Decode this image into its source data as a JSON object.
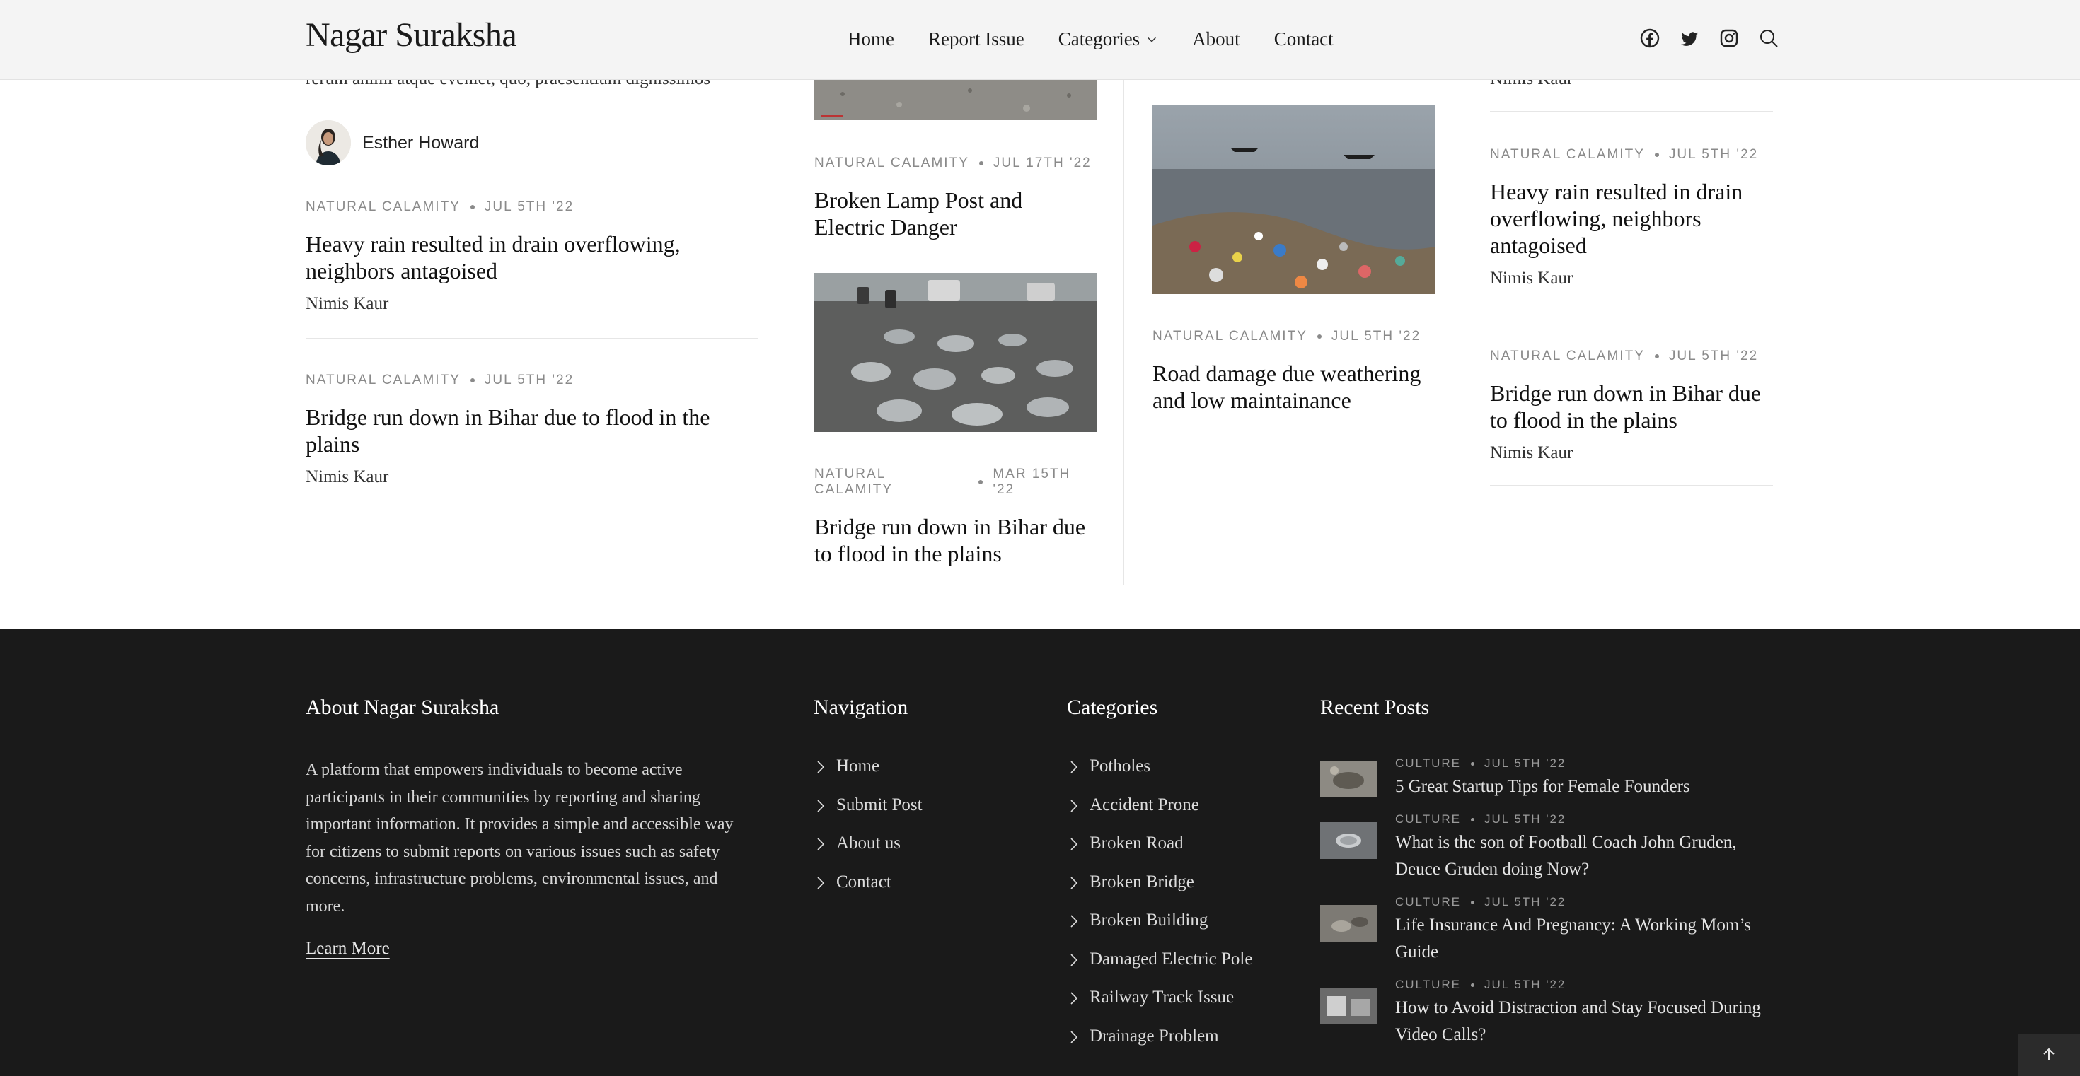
{
  "header": {
    "logo": "Nagar Suraksha",
    "nav": [
      {
        "label": "Home"
      },
      {
        "label": "Report Issue"
      },
      {
        "label": "Categories"
      },
      {
        "label": "About"
      },
      {
        "label": "Contact"
      }
    ]
  },
  "col1": {
    "excerpt_tail": "rerum animi atque eveniet, quo, praesentium dignissimos",
    "author_name": "Esther Howard",
    "posts": [
      {
        "category": "Natural Calamity",
        "date": "Jul 5th '22",
        "title": "Heavy rain resulted in drain overflowing, neighbors antagoised",
        "author": "Nimis Kaur"
      },
      {
        "category": "Natural Calamity",
        "date": "Jul 5th '22",
        "title": "Bridge run down in Bihar due to flood in the plains",
        "author": "Nimis Kaur"
      }
    ]
  },
  "col2": {
    "posts": [
      {
        "category": "Natural Calamity",
        "date": "Jul 17th '22",
        "title": "Broken Lamp Post and Electric Danger"
      },
      {
        "category": "Natural Calamity",
        "date": "Mar 15th '22",
        "title": "Bridge run down in Bihar due to flood in the plains"
      }
    ]
  },
  "col3": {
    "posts": [
      {
        "category": "Natural Calamity",
        "date": "Jul 5th '22",
        "title": "Road damage due weathering and low maintainance"
      }
    ]
  },
  "col4": {
    "top_author": "Nimis Kaur",
    "posts": [
      {
        "category": "Natural Calamity",
        "date": "Jul 5th '22",
        "title": "Heavy rain resulted in drain overflowing, neighbors antagoised",
        "author": "Nimis Kaur"
      },
      {
        "category": "Natural Calamity",
        "date": "Jul 5th '22",
        "title": "Bridge run down in Bihar due to flood in the plains",
        "author": "Nimis Kaur"
      }
    ]
  },
  "footer": {
    "about_heading": "About Nagar Suraksha",
    "about_text": "A platform that empowers individuals to become active participants in their communities by reporting and sharing important information. It provides a simple and accessible way for citizens to submit reports on various issues such as safety concerns, infrastructure problems, environmental issues, and more.",
    "learn_more": "Learn More",
    "nav_heading": "Navigation",
    "nav_links": [
      "Home",
      "Submit Post",
      "About us",
      "Contact"
    ],
    "categories_heading": "Categories",
    "categories": [
      "Potholes",
      "Accident Prone",
      "Broken Road",
      "Broken Bridge",
      "Broken Building",
      "Damaged Electric Pole",
      "Railway Track Issue",
      "Drainage Problem"
    ],
    "recent_heading": "Recent Posts",
    "recent": [
      {
        "category": "Culture",
        "date": "Jul 5th '22",
        "title": "5 Great Startup Tips for Female Founders"
      },
      {
        "category": "Culture",
        "date": "Jul 5th '22",
        "title": "What is the son of Football Coach John Gruden, Deuce Gruden doing Now?"
      },
      {
        "category": "Culture",
        "date": "Jul 5th '22",
        "title": "Life Insurance And Pregnancy: A Working Mom’s Guide"
      },
      {
        "category": "Culture",
        "date": "Jul 5th '22",
        "title": "How to Avoid Distraction and Stay Focused During Video Calls?"
      }
    ]
  },
  "colors": {
    "header_bg": "#f4f4f4",
    "footer_bg": "#1a1a1a",
    "meta_grey": "#8a8a8a"
  },
  "icons": [
    "facebook-icon",
    "twitter-icon",
    "instagram-icon",
    "search-icon",
    "chevron-down-icon",
    "chevron-right-icon",
    "arrow-up-icon"
  ]
}
